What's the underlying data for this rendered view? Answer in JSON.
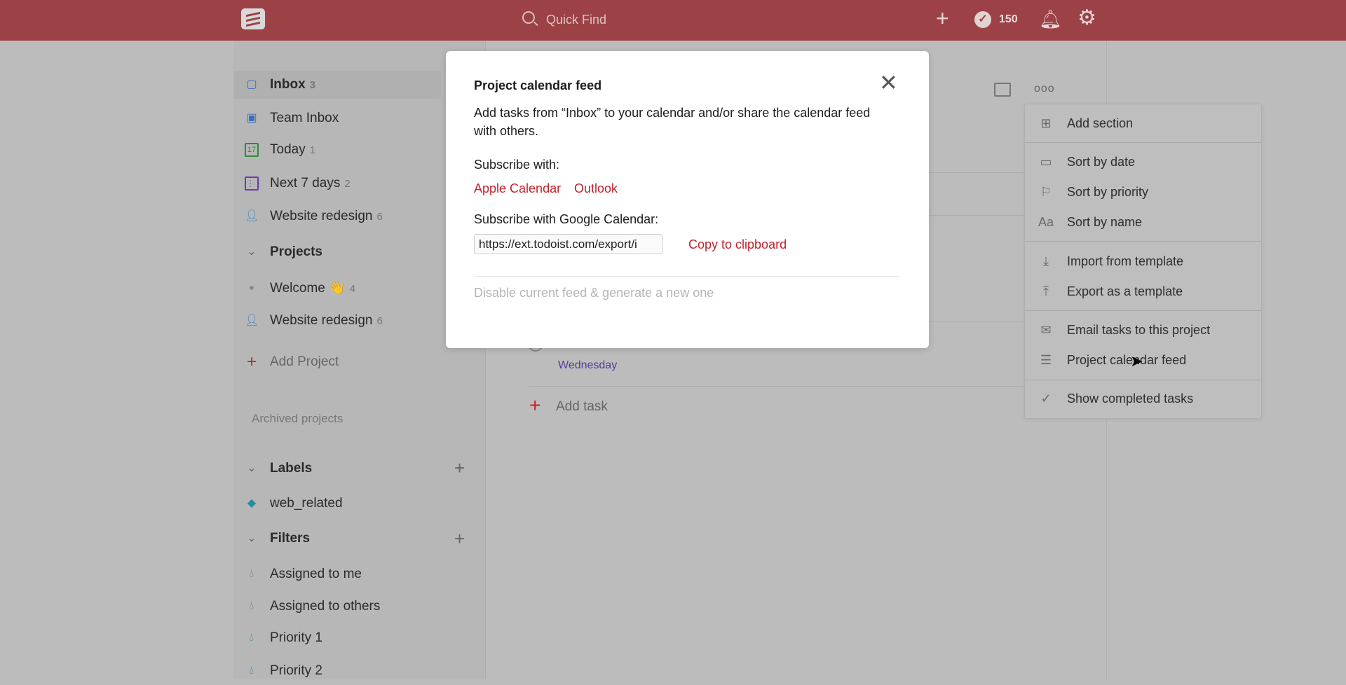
{
  "header": {
    "search_placeholder": "Quick Find",
    "karma": "150",
    "icons": [
      "logo-icon",
      "search-icon",
      "add-icon",
      "karma-check-icon",
      "bell-icon",
      "gear-icon"
    ]
  },
  "sidebar": {
    "items": [
      {
        "label": "Inbox",
        "count": "3",
        "icon": "inbox-icon",
        "color": "#3d6fc0"
      },
      {
        "label": "Team Inbox",
        "count": "",
        "icon": "team-inbox-icon",
        "color": "#3d6fc0"
      },
      {
        "label": "Today",
        "count": "1",
        "icon": "calendar-today-icon",
        "color": "#2f8a3a"
      },
      {
        "label": "Next 7 days",
        "count": "2",
        "icon": "calendar-week-icon",
        "color": "#6a3db3"
      },
      {
        "label": "Website redesign",
        "count": "6",
        "icon": "person-icon",
        "color": "#2d7fc0"
      }
    ],
    "projects_header": "Projects",
    "projects": [
      {
        "label": "Welcome 👋",
        "count": "4",
        "icon": "dot-icon"
      },
      {
        "label": "Website redesign",
        "count": "6",
        "icon": "person-icon"
      }
    ],
    "add_project": "Add Project",
    "archived": "Archived projects",
    "labels_header": "Labels",
    "labels": [
      {
        "label": "web_related",
        "icon": "tag-icon"
      }
    ],
    "filters_header": "Filters",
    "filters": [
      {
        "label": "Assigned to me",
        "color": "#6a6a6a"
      },
      {
        "label": "Assigned to others",
        "color": "#6a6a6a"
      },
      {
        "label": "Priority 1",
        "color": "#2a7a9c"
      },
      {
        "label": "Priority 2",
        "color": "#2a7a9c"
      }
    ]
  },
  "main": {
    "task_date": "Wednesday",
    "add_task": "Add task"
  },
  "modal": {
    "title": "Project calendar feed",
    "desc_line1": "Add tasks from “Inbox” to your calendar and/or share the calendar feed",
    "desc_line2": "with others.",
    "subscribe_with": "Subscribe with:",
    "apple": "Apple Calendar",
    "outlook": "Outlook",
    "google_label": "Subscribe with Google Calendar:",
    "feed_url": "https://ext.todoist.com/export/i",
    "copy": "Copy to clipboard",
    "disable": "Disable current feed & generate a new one"
  },
  "menu": {
    "items": [
      {
        "label": "Add section",
        "icon": "add-section-icon"
      },
      {
        "label": "Sort by date",
        "icon": "calendar-icon"
      },
      {
        "label": "Sort by priority",
        "icon": "flag-icon"
      },
      {
        "label": "Sort by name",
        "icon": "text-icon"
      },
      {
        "label": "Import from template",
        "icon": "download-icon"
      },
      {
        "label": "Export as a template",
        "icon": "upload-icon"
      },
      {
        "label": "Email tasks to this project",
        "icon": "mail-icon"
      },
      {
        "label": "Project calendar feed",
        "icon": "list-icon"
      },
      {
        "label": "Show completed tasks",
        "icon": "check-circle-icon"
      }
    ]
  },
  "colors": {
    "header": "#db4c3f",
    "accent_red": "#c8202a",
    "date_purple": "#692fc2"
  }
}
